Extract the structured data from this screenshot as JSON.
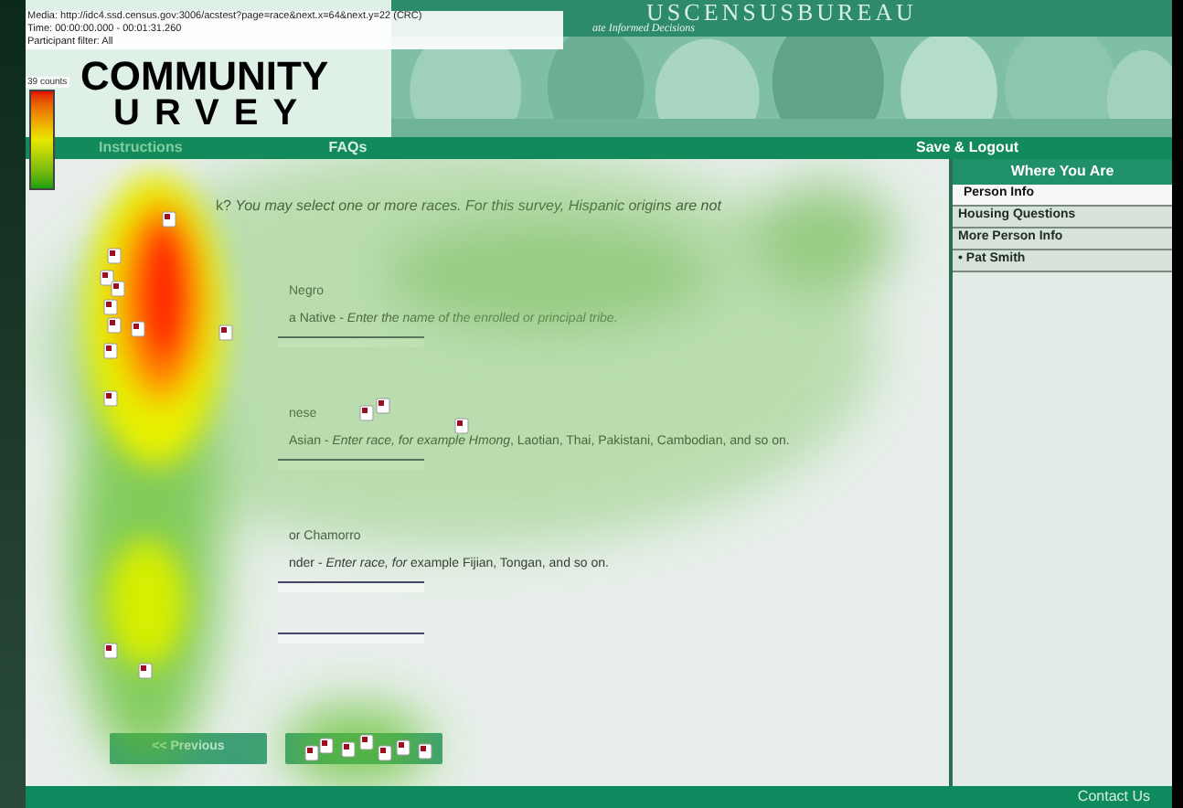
{
  "info_box": {
    "lines": [
      "Media: http://idc4.ssd.census.gov:3006/acstest?page=race&next.x=64&next.y=22 (CRC)",
      "Time: 00:00:00.000 - 00:01:31.260",
      "Participant filter: All"
    ]
  },
  "legend": {
    "label": "39 counts"
  },
  "header": {
    "agency": "USCENSUSBUREAU",
    "tagline": "ate Informed Decisions",
    "logo_top": "COMMUNITY",
    "logo_bottom": "URVEY"
  },
  "nav": [
    {
      "label": "Instructions"
    },
    {
      "label": "FAQs"
    },
    {
      "label": "Save & Logout"
    }
  ],
  "question": "k? *You may select one or more races. For this survey, Hispanic origins are not*",
  "options": [
    {
      "kind": "label",
      "text": "Negro"
    },
    {
      "kind": "field",
      "text": "a Native - *Enter the name of the enrolled or principal tribe.*"
    },
    {
      "kind": "label",
      "text": "nese"
    },
    {
      "kind": "field",
      "text": "Asian - *Enter race, for example Hmong*, Laotian, Thai, Pakistani, Cambodian, and so on."
    },
    {
      "kind": "label",
      "text": "or Chamorro"
    },
    {
      "kind": "field",
      "text": "nder - *Enter race, for* example Fijian, Tongan, and so on."
    }
  ],
  "previous_button": {
    "label": "<< Previous"
  },
  "sidebar": {
    "title": "Where You Are",
    "items": [
      {
        "label": "Person Info",
        "selected": true
      },
      {
        "label": "Housing Questions",
        "selected": false
      },
      {
        "label": "More Person Info",
        "selected": false
      },
      {
        "label": "• Pat Smith",
        "selected": false
      }
    ]
  },
  "footer": {
    "link": "Contact Us"
  }
}
